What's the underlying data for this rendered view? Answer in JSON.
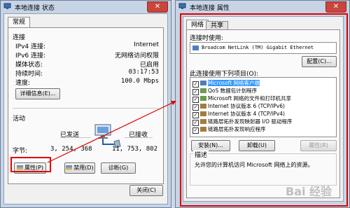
{
  "status_window": {
    "title": "本地连接 状态",
    "tab": "常规",
    "connection_header": "连接",
    "rows": [
      {
        "label": "IPv4 连接:",
        "value": "Internet"
      },
      {
        "label": "IPv6 连接:",
        "value": "无网络访问权限"
      },
      {
        "label": "媒体状态:",
        "value": "已启用"
      },
      {
        "label": "持续时间:",
        "value": "03:17:53"
      },
      {
        "label": "速度:",
        "value": "100.0 Mbps"
      }
    ],
    "details_button": "详细信息(E)...",
    "activity_header": "活动",
    "sent_label": "已发送",
    "received_label": "已接收",
    "bytes_label": "字节:",
    "bytes_sent": "3, 254, 368",
    "bytes_received": "11, 753, 802",
    "properties_button": "属性(P)",
    "disable_button": "禁用(D)",
    "diagnose_button": "诊断(G)",
    "close_button": "关闭(C)"
  },
  "properties_window": {
    "title": "本地连接 属性",
    "tabs": [
      "网络",
      "共享"
    ],
    "connect_using_label": "连接时使用:",
    "adapter_name": "Broadcom NetLink (TM) Gigabit Ethernet",
    "configure_button": "配置(C)...",
    "items_label": "此连接使用下列项目(O):",
    "items": [
      {
        "label": "Microsoft 网络客户端",
        "checked": true,
        "selected": true
      },
      {
        "label": "QoS 数据包计划程序",
        "checked": true,
        "selected": false
      },
      {
        "label": "Microsoft 网络的文件和打印机共享",
        "checked": true,
        "selected": false
      },
      {
        "label": "Internet 协议版本 6 (TCP/IPv6)",
        "checked": true,
        "selected": false
      },
      {
        "label": "Internet 协议版本 4 (TCP/IPv4)",
        "checked": true,
        "selected": false
      },
      {
        "label": "链路层拓扑发现映射器 I/O 驱动程序",
        "checked": true,
        "selected": false
      },
      {
        "label": "链路层拓扑发现响应程序",
        "checked": true,
        "selected": false
      }
    ],
    "install_button": "安装(N)...",
    "uninstall_button": "卸载(U)",
    "properties_button": "属性(R)",
    "description_header": "描述",
    "description_text": "允许您的计算机访问 Microsoft 网络上的资源。"
  },
  "watermark": "Bai 经验",
  "colors": {
    "highlight_border": "#e00000",
    "selection": "#3399ff",
    "close_button": "#c9463d"
  }
}
